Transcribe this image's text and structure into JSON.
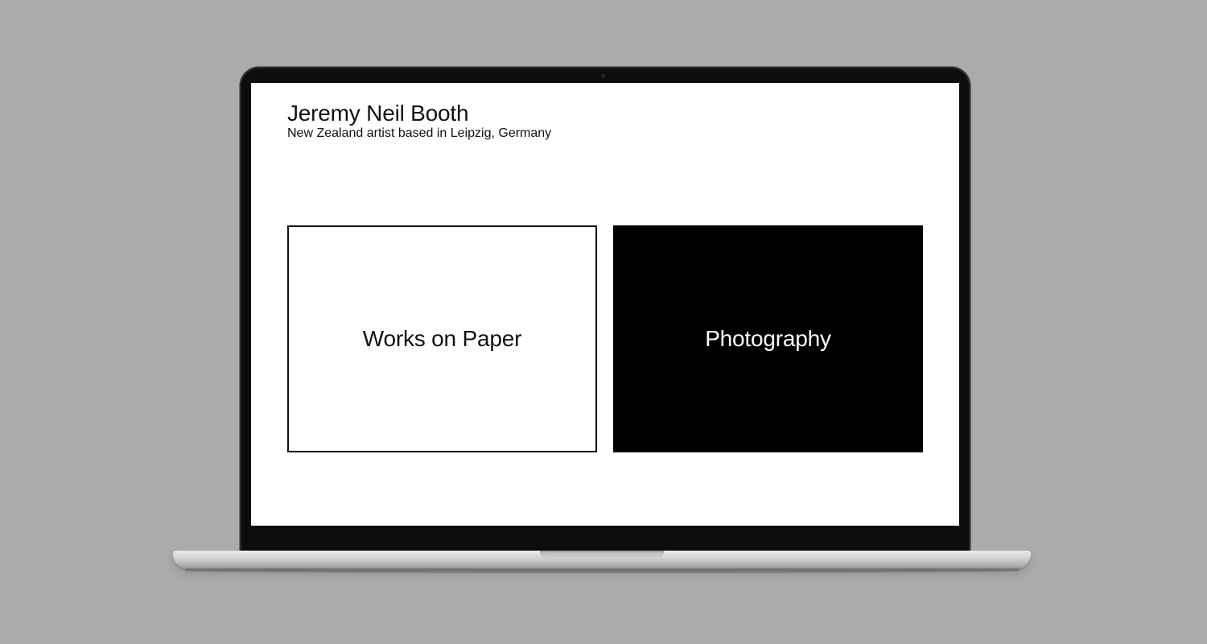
{
  "site": {
    "title": "Jeremy Neil Booth",
    "subtitle": "New Zealand artist based in Leipzig, Germany"
  },
  "tiles": [
    {
      "label": "Works on Paper",
      "style": "outlined"
    },
    {
      "label": "Photography",
      "style": "filled"
    }
  ],
  "colors": {
    "background": "#ababab",
    "screen": "#ffffff",
    "ink": "#111111",
    "tile_dark": "#000000",
    "tile_dark_text": "#ffffff"
  }
}
